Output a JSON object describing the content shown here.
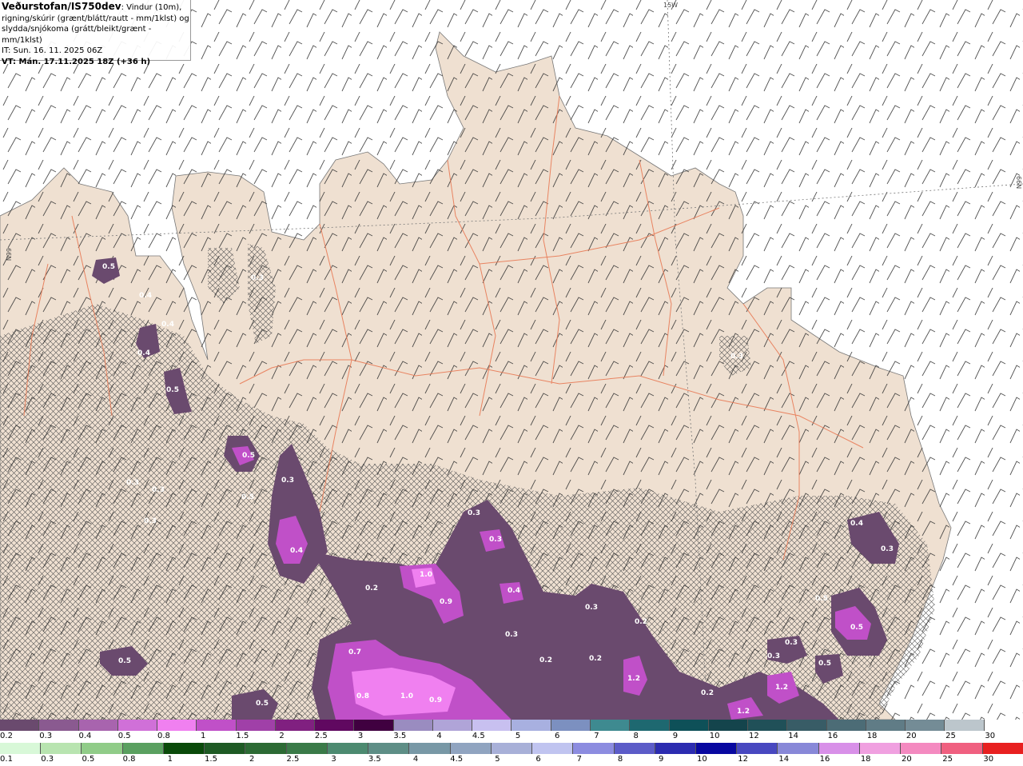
{
  "info": {
    "title": "Veðurstofan/IS750dev",
    "desc1": ": Vindur (10m),",
    "desc2": "rigning/skúrir (grænt/blátt/rautt - mm/1klst) og",
    "desc3": "slydda/snjókoma (grátt/bleikt/grænt - mm/1klst)",
    "it": "IT: Sun. 16. 11. 2025 06Z",
    "vt": "VT: Mán. 17.11.2025 18Z (+36 h)"
  },
  "graticule": {
    "lon_label": "15W",
    "lat_label_left": "66N",
    "lat_label_right": "66N"
  },
  "contour_labels": [
    "0.5",
    "0.4",
    "0.5",
    "0.4",
    "0.5",
    "0.3",
    "0.3",
    "0.3",
    "0.5",
    "0.3",
    "0.2",
    "0.3",
    "0.3",
    "0.4",
    "0.2",
    "1.0",
    "0.9",
    "0.4",
    "0.3",
    "0.2",
    "0.2",
    "0.3",
    "0.2",
    "1.2",
    "0.3",
    "0.7",
    "0.8",
    "1.0",
    "0.9",
    "0.5",
    "0.5",
    "0.3",
    "1.2",
    "1.2",
    "0.3",
    "0.4",
    "0.5",
    "0.5",
    "0.5",
    "0.3",
    "0.4",
    "0.3"
  ],
  "scale_snow": {
    "labels": [
      "0.2",
      "0.3",
      "0.4",
      "0.5",
      "0.8",
      "1",
      "1.5",
      "2",
      "2.5",
      "3",
      "3.5",
      "4",
      "4.5",
      "5",
      "6",
      "7",
      "8",
      "9",
      "10",
      "12",
      "14",
      "16",
      "18",
      "20",
      "25",
      "30"
    ],
    "colors": [
      "#6a4a6e",
      "#8a5a90",
      "#a864ae",
      "#d070d8",
      "#f080f0",
      "#c050c8",
      "#a040a8",
      "#802080",
      "#600860",
      "#400040",
      "#9a8cc0",
      "#b0a4d8",
      "#c8c0f0",
      "#a8b0e0",
      "#7c90c0",
      "#3e8a90",
      "#1e6870",
      "#0e5058",
      "#14444c",
      "#205058",
      "#385c66",
      "#4c6c76",
      "#607c86",
      "#748c96",
      "#bcc6cc",
      "#ffffff"
    ]
  },
  "scale_rain": {
    "labels": [
      "0.1",
      "0.3",
      "0.5",
      "0.8",
      "1",
      "1.5",
      "2",
      "2.5",
      "3",
      "3.5",
      "4",
      "4.5",
      "5",
      "6",
      "7",
      "8",
      "9",
      "10",
      "12",
      "14",
      "16",
      "18",
      "20",
      "25",
      "30"
    ],
    "colors": [
      "#d8f8d8",
      "#b8e4b0",
      "#90cc88",
      "#5aa060",
      "#0a4a0a",
      "#1e5a24",
      "#2c6a34",
      "#3a7a48",
      "#4c8a70",
      "#5e8e86",
      "#7898a6",
      "#90a4c0",
      "#a8b0d8",
      "#c0c4f0",
      "#8c8ce0",
      "#5c5cc8",
      "#2c2cb0",
      "#0808a0",
      "#4848c0",
      "#8888d8",
      "#d890e8",
      "#f0a0e0",
      "#f48ac0",
      "#f06080",
      "#e82020"
    ]
  }
}
